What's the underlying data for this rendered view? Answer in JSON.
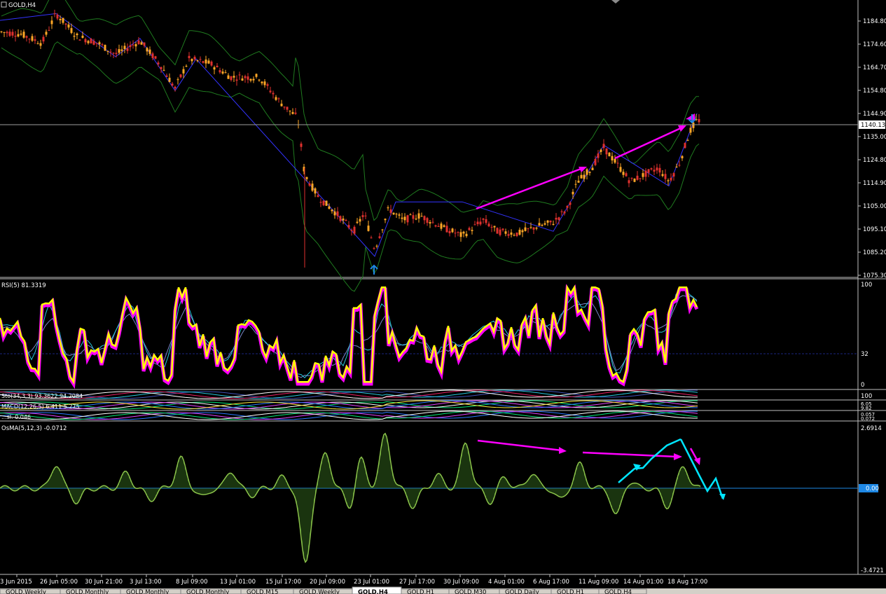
{
  "window": {
    "symbol_title": "GOLD,H4"
  },
  "main_chart": {
    "price_labels": [
      "1184.80",
      "1174.60",
      "1164.70",
      "1154.80",
      "1144.90",
      "1135.00",
      "1124.80",
      "1114.90",
      "1105.00",
      "1095.10",
      "1085.20",
      "1075.30"
    ],
    "current_price": "1140.13",
    "price_range": [
      1070,
      1192
    ]
  },
  "rsi_panel": {
    "title": "RSI(5) 81.3319",
    "levels": [
      "100",
      "32",
      "0"
    ]
  },
  "stoch_panel": {
    "title": "Sto(34,3,3) 93.3622 94.2084",
    "level": "100"
  },
  "macd_panel": {
    "title": "MACD(12,26,5) 6.411 5.275",
    "levels": [
      "6.05",
      "9.82"
    ]
  },
  "third_panel": {
    "title": "...sl. 0.046",
    "levels": [
      "0.057",
      "0.072"
    ]
  },
  "osma_panel": {
    "title": "OsMA(5,12,3) -0.0712",
    "levels": [
      "2.6914",
      "0.00",
      "-3.4721"
    ]
  },
  "time_axis": [
    "3 Jun 2015",
    "26 Jun 05:00",
    "30 Jun 21:00",
    "3 Jul 13:00",
    "8 Jul 09:00",
    "13 Jul 01:00",
    "15 Jul 17:00",
    "20 Jul 09:00",
    "23 Jul 01:00",
    "27 Jul 17:00",
    "30 Jul 09:00",
    "4 Aug 01:00",
    "6 Aug 17:00",
    "11 Aug 09:00",
    "14 Aug 01:00",
    "18 Aug 17:00"
  ],
  "tabs": [
    {
      "label": "GOLD,Weekly",
      "active": false
    },
    {
      "label": "GOLD,Monthly",
      "active": false
    },
    {
      "label": "GOLD,Monthly",
      "active": false
    },
    {
      "label": "GOLD,Monthly",
      "active": false
    },
    {
      "label": "GOLD,M15",
      "active": false
    },
    {
      "label": "GOLD,Weekly",
      "active": false
    },
    {
      "label": "GOLD,H4",
      "active": true
    },
    {
      "label": "GOLD,H1",
      "active": false
    },
    {
      "label": "GOLD,M30",
      "active": false
    },
    {
      "label": "GOLD,Daily",
      "active": false
    },
    {
      "label": "GOLD,H1",
      "active": false
    },
    {
      "label": "GOLD,H4",
      "active": false
    }
  ],
  "colors": {
    "background": "#000000",
    "bull_candle": "#ffa726",
    "bear_candle": "#e0312e",
    "bands": "#1f7a1f",
    "zigzag": "#3333ff",
    "rsi_main": "#ffff00",
    "rsi_glow": "#ff00ff",
    "osma_hist": "#8bc34a",
    "arrow_magenta": "#ff00ff",
    "arrow_cyan": "#00e5ff",
    "zero_line": "#1e88e5"
  }
}
